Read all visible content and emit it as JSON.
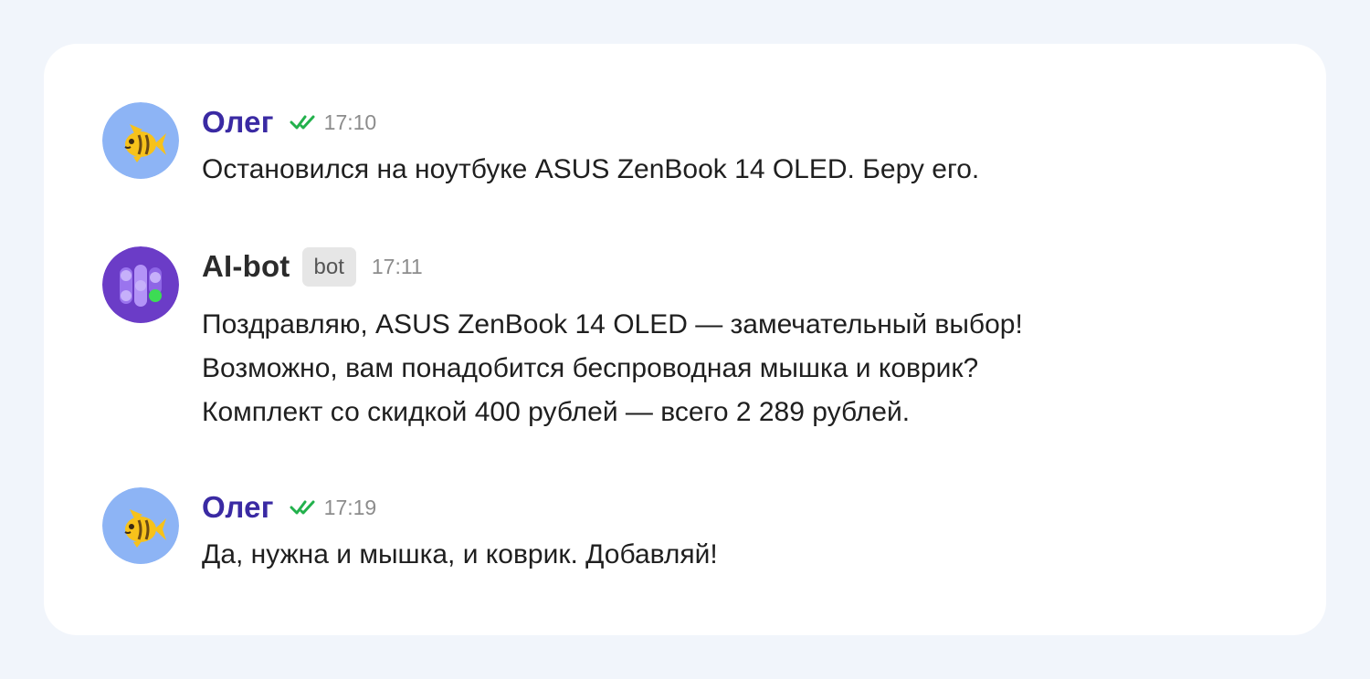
{
  "messages": [
    {
      "author": "Олег",
      "time": "17:10",
      "avatar_icon": "fish-icon",
      "status_icon": "double-check-icon",
      "lines": [
        "Остановился на ноутбуке ASUS ZenBook 14 OLED. Беру его."
      ]
    },
    {
      "author": "AI-bot",
      "badge": "bot",
      "time": "17:11",
      "avatar_icon": "ai-bot-logo-icon",
      "lines": [
        "Поздравляю, ASUS ZenBook 14 OLED — замечательный выбор!",
        "Возможно, вам понадобится беспроводная мышка и коврик?",
        "Комплект со скидкой 400 рублей — всего 2 289 рублей."
      ]
    },
    {
      "author": "Олег",
      "time": "17:19",
      "avatar_icon": "fish-icon",
      "status_icon": "double-check-icon",
      "lines": [
        "Да, нужна и мышка, и коврик. Добавляй!"
      ]
    }
  ],
  "colors": {
    "page_background": "#f1f5fb",
    "card_background": "#ffffff",
    "user_name": "#3a2aa3",
    "bot_name": "#2b2b2b",
    "read_check": "#22b14c",
    "timestamp": "#8c8c8c",
    "badge_background": "#e6e6e6",
    "user_avatar_background": "#8db4f5",
    "bot_avatar_background": "#6b3cc7"
  }
}
